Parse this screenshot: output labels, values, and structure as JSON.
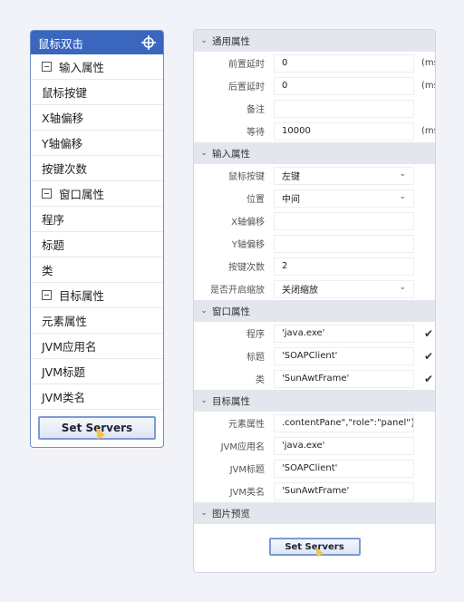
{
  "left": {
    "title": "鼠标双击",
    "items": [
      {
        "label": "输入属性",
        "group": true
      },
      {
        "label": "鼠标按键",
        "group": false
      },
      {
        "label": "X轴偏移",
        "group": false
      },
      {
        "label": "Y轴偏移",
        "group": false
      },
      {
        "label": "按键次数",
        "group": false
      },
      {
        "label": "窗口属性",
        "group": true
      },
      {
        "label": "程序",
        "group": false
      },
      {
        "label": "标题",
        "group": false
      },
      {
        "label": "类",
        "group": false
      },
      {
        "label": "目标属性",
        "group": true
      },
      {
        "label": "元素属性",
        "group": false
      },
      {
        "label": "JVM应用名",
        "group": false
      },
      {
        "label": "JVM标题",
        "group": false
      },
      {
        "label": "JVM类名",
        "group": false
      }
    ],
    "button": "Set Servers"
  },
  "right": {
    "sections": [
      {
        "title": "通用属性",
        "rows": [
          {
            "label": "前置延时",
            "value": "0",
            "unit": "(ms"
          },
          {
            "label": "后置延时",
            "value": "0",
            "unit": "(ms"
          },
          {
            "label": "备注",
            "value": ""
          },
          {
            "label": "等待",
            "value": "10000",
            "unit": "(ms"
          }
        ]
      },
      {
        "title": "输入属性",
        "rows": [
          {
            "label": "鼠标按键",
            "value": "左键",
            "dropdown": true
          },
          {
            "label": "位置",
            "value": "中间",
            "dropdown": true
          },
          {
            "label": "X轴偏移",
            "value": ""
          },
          {
            "label": "Y轴偏移",
            "value": ""
          },
          {
            "label": "按键次数",
            "value": "2"
          },
          {
            "label": "是否开启缩放",
            "value": "关闭缩放",
            "dropdown": true
          }
        ]
      },
      {
        "title": "窗口属性",
        "rows": [
          {
            "label": "程序",
            "value": "'java.exe'",
            "check": true
          },
          {
            "label": "标题",
            "value": "'SOAPClient'",
            "check": true
          },
          {
            "label": "类",
            "value": "'SunAwtFrame'",
            "check": true
          }
        ]
      },
      {
        "title": "目标属性",
        "rows": [
          {
            "label": "元素属性",
            "value": ".contentPane\",\"role\":\"panel\"}]"
          },
          {
            "label": "JVM应用名",
            "value": "'java.exe'"
          },
          {
            "label": "JVM标题",
            "value": "'SOAPClient'"
          },
          {
            "label": "JVM类名",
            "value": "'SunAwtFrame'"
          }
        ]
      },
      {
        "title": "图片预览",
        "rows": []
      }
    ],
    "button": "Set Servers"
  },
  "icons": {
    "crosshair": "crosshair-icon",
    "chevron": "chevron-down-icon",
    "check": "check-icon"
  },
  "colors": {
    "header_blue": "#3a66be",
    "section_bg": "#e3e6ed",
    "page_bg": "#f1f3f9"
  }
}
